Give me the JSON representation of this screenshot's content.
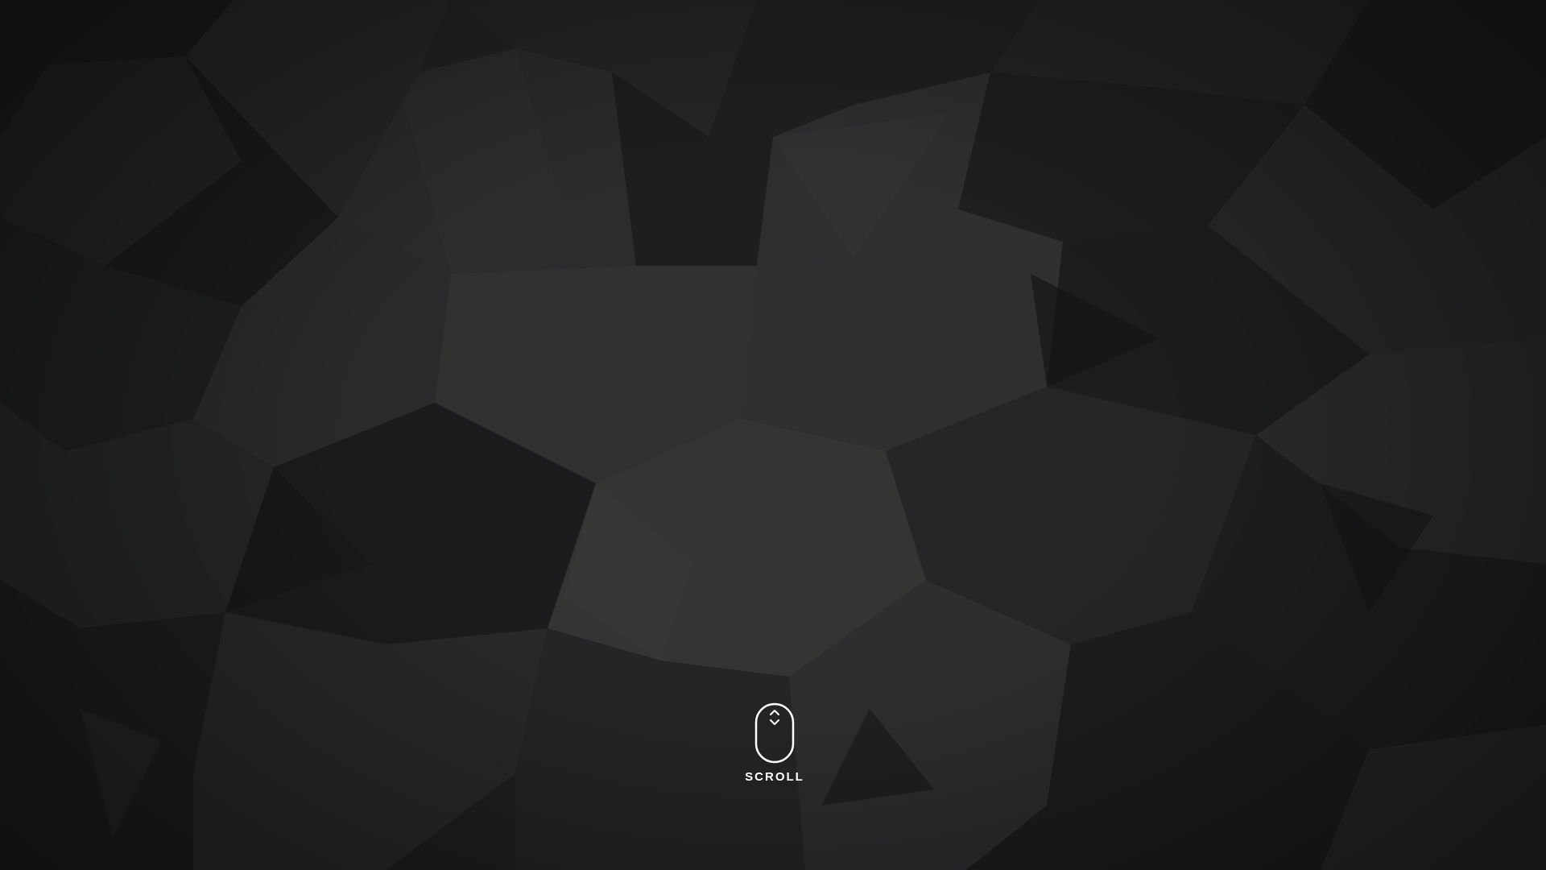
{
  "background": {
    "base_color": "#1e1f21",
    "highlight_color": "#3b3f3d",
    "pattern": "low-poly-geometric"
  },
  "scroll_hint": {
    "icon": "mouse-scroll-icon",
    "label": "SCROLL",
    "color": "#ffffff"
  }
}
